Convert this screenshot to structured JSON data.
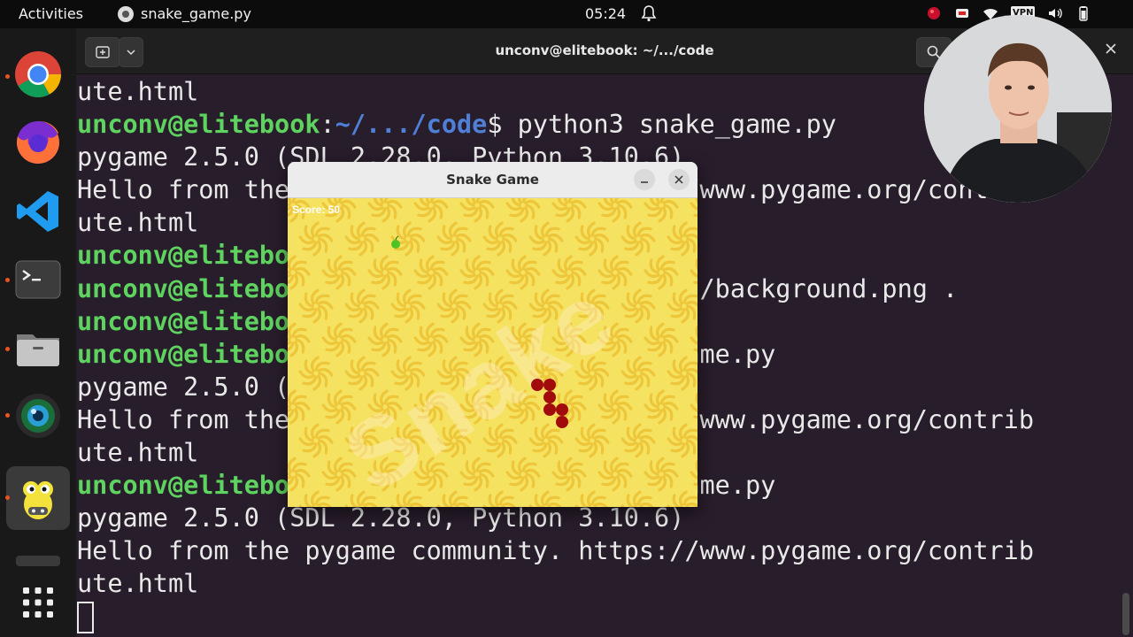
{
  "topbar": {
    "activities": "Activities",
    "app_name": "snake_game.py",
    "clock": "05:24",
    "vpn": "VPN"
  },
  "dock": {
    "items": [
      "chrome-icon",
      "firefox-icon",
      "vscode-icon",
      "terminal-icon",
      "files-icon",
      "camera-icon",
      "pygame-icon",
      "app-grid-icon"
    ]
  },
  "terminal": {
    "title": "unconv@elitebook: ~/.../code",
    "lines": [
      {
        "text": "ute.html"
      },
      {
        "user": "unconv@elitebook",
        "path": "~/.../code",
        "cmd": "$ python3 snake_game.py"
      },
      {
        "text": "pygame 2.5.0 (SDL 2.28.0, Python 3.10.6)"
      },
      {
        "text": "Hello from the pygame community. https://www.pygame.org/contrib"
      },
      {
        "text": "ute.html"
      },
      {
        "user": "unconv@elitebook",
        "path": "",
        "cmd": "                  /"
      },
      {
        "user": "unconv@elitebook",
        "path": "",
        "cmd": "                  wnloads/background.png ."
      },
      {
        "user": "unconv@elitebook",
        "path": "",
        "cmd": ""
      },
      {
        "user": "unconv@elitebook",
        "path": "",
        "cmd": "                  nake_game.py"
      },
      {
        "text": "pygame 2.5.0 (SDL 2.28.0, Python 3.10.6)"
      },
      {
        "text": "Hello from the pygame community. https://www.pygame.org/contrib"
      },
      {
        "text": "ute.html"
      },
      {
        "user": "unconv@elitebook",
        "path": "",
        "cmd": "                  nake_game.py"
      },
      {
        "text": "pygame 2.5.0 (SDL 2.28.0, Python 3.10.6)"
      },
      {
        "text": "Hello from the pygame community. https://www.pygame.org/contrib"
      },
      {
        "text": "ute.html"
      }
    ]
  },
  "game": {
    "title": "Snake Game",
    "score": "Score: 50",
    "watermark": "Snake",
    "colors": {
      "background": "#f5e261",
      "swirl": "#eec63a",
      "snake": "#a10b0b",
      "apple": "#4ec227"
    }
  }
}
